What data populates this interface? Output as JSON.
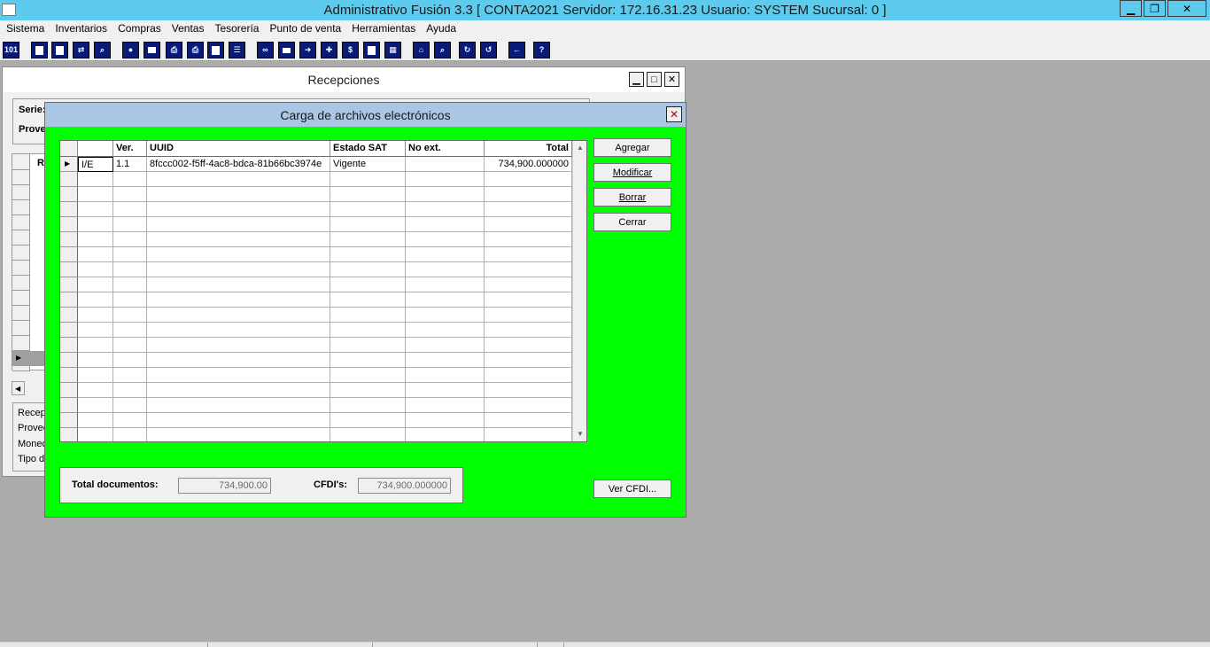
{
  "window": {
    "title": "Administrativo Fusión 3.3 [ CONTA2021   Servidor: 172.16.31.23    Usuario: SYSTEM     Sucursal: 0 ]",
    "minimize": "▁",
    "restore": "❐",
    "close": "✕"
  },
  "menu": [
    "Sistema",
    "Inventarios",
    "Compras",
    "Ventas",
    "Tesorería",
    "Punto de venta",
    "Herramientas",
    "Ayuda"
  ],
  "toolbar": {
    "first_button": "101",
    "icons": [
      "id-icon",
      "copy-icon",
      "clipboard-icon",
      "swap-icon",
      "zoom-icon",
      "user-icon",
      "folder-icon",
      "print-preview-icon",
      "printer-icon",
      "document-icon",
      "list-icon",
      "binoculars-icon",
      "drive-icon",
      "export-icon",
      "add-icon",
      "dollar-icon",
      "report-icon",
      "table-icon",
      "home-icon",
      "search-icon",
      "refresh-icon",
      "undo-icon",
      "back-icon",
      "help-icon"
    ],
    "help_label": "?"
  },
  "recepciones": {
    "title": "Recepciones",
    "serie_label": "Serie:",
    "proveedor_label": "Prove",
    "col_r": "R",
    "bottom_labels": [
      "Recepc",
      "Provee",
      "Moned",
      "Tipo de"
    ]
  },
  "dialog": {
    "title": "Carga de archivos electrónicos",
    "close": "✕",
    "columns": [
      "",
      "Ver.",
      "UUID",
      "Estado SAT",
      "No ext.",
      "Total"
    ],
    "rows": [
      {
        "tipo": "I/E",
        "ver": "1.1",
        "uuid": "8fccc002-f5ff-4ac8-bdca-81b66bc3974e",
        "estado": "Vigente",
        "noext": "",
        "total": "734,900.000000"
      }
    ],
    "buttons": {
      "agregar": "Agregar",
      "modificar": "Modificar",
      "borrar": "Borrar",
      "cerrar": "Cerrar",
      "ver_cfdi": "Ver CFDI..."
    },
    "totals": {
      "total_docs_label": "Total documentos:",
      "total_docs_value": "734,900.00",
      "cfdis_label": "CFDI's:",
      "cfdis_value": "734,900.000000"
    }
  }
}
